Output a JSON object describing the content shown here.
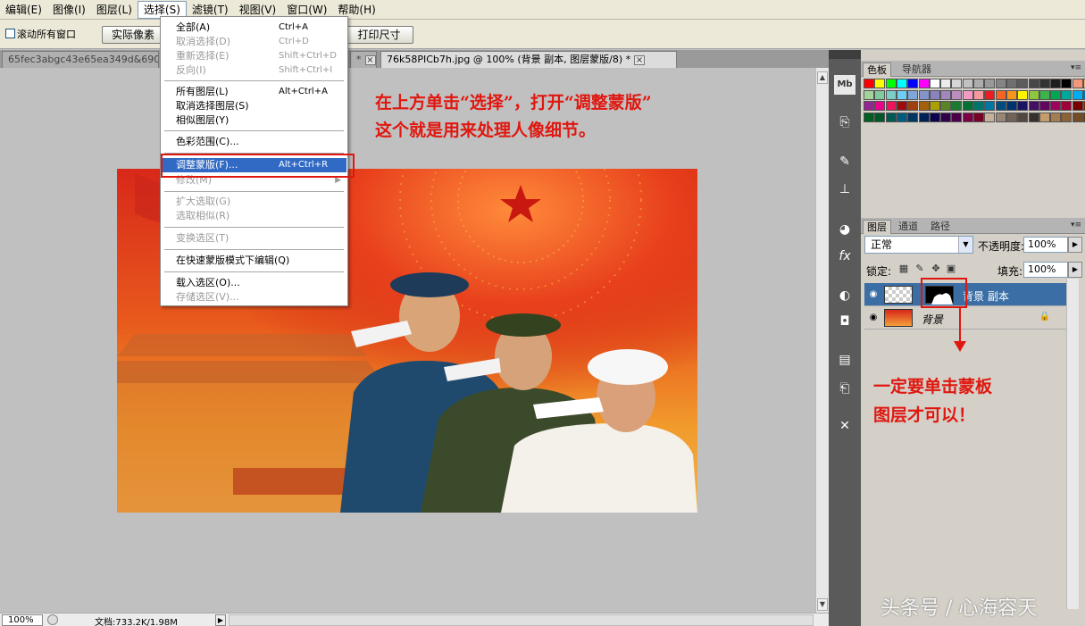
{
  "menu_bar": {
    "items": [
      "编辑(E)",
      "图像(I)",
      "图层(L)",
      "选择(S)",
      "滤镜(T)",
      "视图(V)",
      "窗口(W)",
      "帮助(H)"
    ],
    "active_index": 3
  },
  "options_bar": {
    "scroll_all_label": "滚动所有窗口",
    "actual_pixels_label": "实际像素",
    "print_size_label": "打印尺寸"
  },
  "doc_tabs": [
    {
      "title": "65fec3abgc43e65ea349d&690",
      "close": "×"
    },
    {
      "title": "*",
      "close": "×"
    },
    {
      "title": "76k58PICb7h.jpg @ 100% (背景 副本, 图层蒙版/8) *",
      "close": "×"
    }
  ],
  "select_menu": {
    "items": [
      {
        "label": "全部(A)",
        "shortcut": "Ctrl+A",
        "disabled": false
      },
      {
        "label": "取消选择(D)",
        "shortcut": "Ctrl+D",
        "disabled": true
      },
      {
        "label": "重新选择(E)",
        "shortcut": "Shift+Ctrl+D",
        "disabled": true
      },
      {
        "label": "反向(I)",
        "shortcut": "Shift+Ctrl+I",
        "disabled": true
      },
      {
        "label": "所有图层(L)",
        "shortcut": "Alt+Ctrl+A",
        "disabled": false
      },
      {
        "label": "取消选择图层(S)",
        "shortcut": "",
        "disabled": false
      },
      {
        "label": "相似图层(Y)",
        "shortcut": "",
        "disabled": false
      },
      {
        "label": "色彩范围(C)...",
        "shortcut": "",
        "disabled": false
      },
      {
        "label": "调整蒙版(F)...",
        "shortcut": "Alt+Ctrl+R",
        "disabled": false,
        "highlighted": true
      },
      {
        "label": "修改(M)",
        "shortcut": "",
        "disabled": true,
        "submenu": "▶"
      },
      {
        "label": "扩大选取(G)",
        "shortcut": "",
        "disabled": true
      },
      {
        "label": "选取相似(R)",
        "shortcut": "",
        "disabled": true
      },
      {
        "label": "变换选区(T)",
        "shortcut": "",
        "disabled": true
      },
      {
        "label": "在快速蒙版模式下编辑(Q)",
        "shortcut": "",
        "disabled": false
      },
      {
        "label": "载入选区(O)...",
        "shortcut": "",
        "disabled": false
      },
      {
        "label": "存储选区(V)...",
        "shortcut": "",
        "disabled": true
      }
    ]
  },
  "annotations": {
    "top_line1": "在上方单击“选择”，打开“调整蒙版”",
    "top_line2": "这个就是用来处理人像细节。",
    "right_line1": "一定要单击蒙板",
    "right_line2": "图层才可以！",
    "color": "#e0170f"
  },
  "status_bar": {
    "zoom": "100%",
    "doc_size": "文档:733.2K/1.98M"
  },
  "swatches_panel": {
    "tabs": [
      "色板",
      "导航器"
    ]
  },
  "layers_panel": {
    "tabs": [
      "图层",
      "通道",
      "路径"
    ],
    "blend_mode": "正常",
    "opacity_label": "不透明度:",
    "opacity_value": "100%",
    "lock_label": "锁定:",
    "fill_label": "填充:",
    "fill_value": "100%",
    "layers": [
      {
        "name": "背景 副本",
        "selected": true
      },
      {
        "name": "背景",
        "selected": false
      }
    ]
  },
  "watermark": "头条号 / 心海容天",
  "accent_colors": {
    "menu_highlight": "#316ac5",
    "layer_selected": "#3a6ea5"
  }
}
